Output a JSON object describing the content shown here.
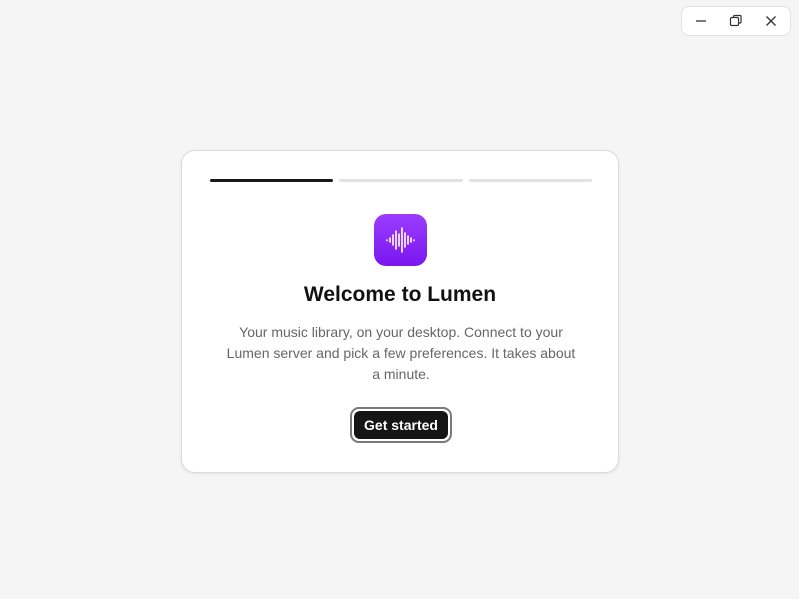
{
  "window_controls": {
    "minimize_icon": "minimize-icon",
    "restore_icon": "restore-icon",
    "close_icon": "close-icon"
  },
  "onboarding": {
    "steps_total": 3,
    "current_step": 1,
    "app_icon": "waveform-icon",
    "title": "Welcome to Lumen",
    "description": "Your music library, on your desktop. Connect to your Lumen server and pick a few preferences. It takes about a minute.",
    "cta_label": "Get started"
  },
  "colors": {
    "background": "#f5f5f5",
    "card": "#ffffff",
    "accent_purple": "#8a2be2",
    "progress_active": "#1a1a1a",
    "progress_inactive": "#e3e3e3",
    "button": "#151515"
  }
}
